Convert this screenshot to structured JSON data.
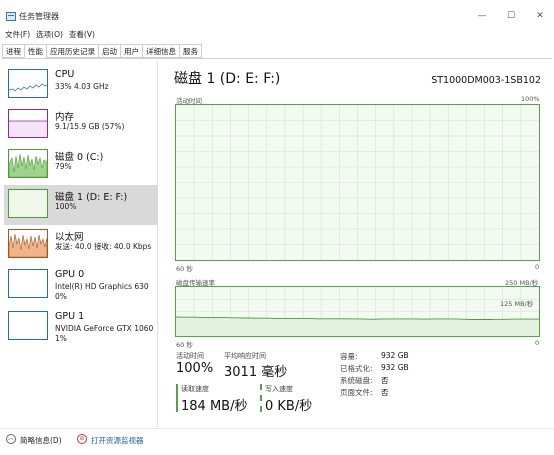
{
  "window": {
    "title": "任务管理器",
    "minimize": "—",
    "maximize": "☐",
    "close": "✕"
  },
  "menu": [
    "文件(F)",
    "选项(O)",
    "查看(V)"
  ],
  "tabs": [
    "进程",
    "性能",
    "应用历史记录",
    "启动",
    "用户",
    "详细信息",
    "服务"
  ],
  "active_tab": "性能",
  "sidebar": {
    "items": [
      {
        "name": "CPU",
        "line1": "33% 4.03 GHz",
        "line2": "",
        "color": "#1d6fb7"
      },
      {
        "name": "内存",
        "line1": "9.1/15.9 GB (57%)",
        "line2": "",
        "color": "#8b2a9b"
      },
      {
        "name": "磁盘 0 (C:)",
        "line1": "79%",
        "line2": "",
        "color": "#4d9a36"
      },
      {
        "name": "磁盘 1 (D: E: F:)",
        "line1": "100%",
        "line2": "",
        "color": "#4d9a36"
      },
      {
        "name": "以太网",
        "line1": "发送: 40.0 接收: 40.0 Kbps",
        "line2": "",
        "color": "#a8541c"
      },
      {
        "name": "GPU 0",
        "line1": "Intel(R) HD Graphics 630",
        "line2": "0%",
        "color": "#1d6fb7"
      },
      {
        "name": "GPU 1",
        "line1": "NVIDIA GeForce GTX 1060",
        "line2": "1%",
        "color": "#1d6fb7"
      }
    ],
    "selected_index": 3
  },
  "main": {
    "title": "磁盘 1 (D: E: F:)",
    "model": "ST1000DM003-1SB102",
    "activity_chart": {
      "label": "活动时间",
      "max": "100%",
      "time_left": "60 秒",
      "time_right": "0"
    },
    "transfer_chart": {
      "label": "磁盘传输速率",
      "max": "250 MB/秒",
      "mid": "125 MB/秒",
      "time_left": "60 秒",
      "time_right": "0"
    },
    "stats": {
      "active_time_label": "活动时间",
      "active_time": "100%",
      "response_label": "平均响应时间",
      "response": "3011 毫秒",
      "read_label": "读取速度",
      "read": "184 MB/秒",
      "write_label": "写入速度",
      "write": "0 KB/秒"
    },
    "properties": [
      {
        "key": "容量:",
        "value": "932 GB"
      },
      {
        "key": "已格式化:",
        "value": "932 GB"
      },
      {
        "key": "系统磁盘:",
        "value": "否"
      },
      {
        "key": "页面文件:",
        "value": "否"
      }
    ]
  },
  "footer": {
    "brief": "简略信息(D)",
    "open_monitor": "打开资源监视器"
  },
  "chart_data": {
    "type": "line",
    "series": [
      {
        "name": "",
        "values": [
          97,
          96,
          96,
          96,
          95,
          95,
          95,
          94,
          94,
          93,
          93,
          92,
          92,
          91,
          91,
          91,
          90,
          90,
          90,
          89,
          89,
          89,
          89,
          88,
          88,
          88,
          88,
          88,
          88,
          87,
          87,
          86,
          85,
          86,
          87,
          87,
          87,
          87,
          87,
          87,
          86,
          86,
          87,
          87,
          87,
          87,
          86,
          85,
          84,
          84,
          84,
          84,
          85,
          85,
          85,
          86,
          86,
          86,
          86,
          86
        ]
      }
    ],
    "xlabel": "",
    "ylabel": "",
    "ylim": [
      0,
      250
    ]
  }
}
